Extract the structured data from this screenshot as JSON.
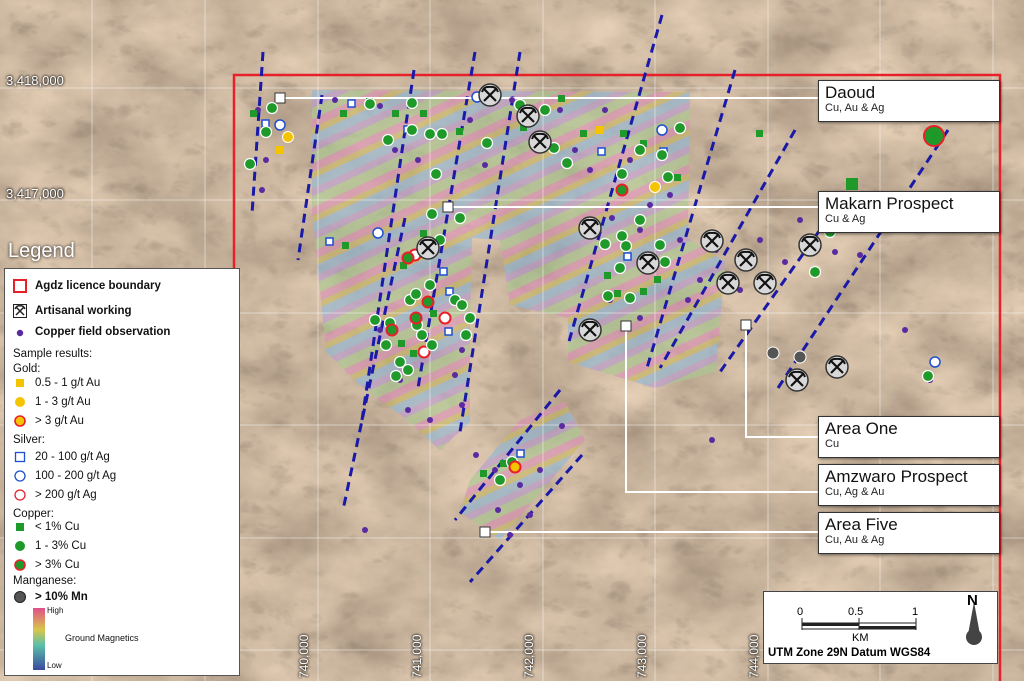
{
  "coordinates": {
    "northing": [
      "3,418,000",
      "3,417,000"
    ],
    "easting": [
      "740,000",
      "741,000",
      "742,000",
      "743,000",
      "744,000"
    ]
  },
  "callouts": [
    {
      "title": "Daoud",
      "sub": "Cu, Au & Ag"
    },
    {
      "title": "Makarn Prospect",
      "sub": "Cu & Ag"
    },
    {
      "title": "Area One",
      "sub": "Cu"
    },
    {
      "title": "Amzwaro Prospect",
      "sub": "Cu, Ag & Au"
    },
    {
      "title": "Area Five",
      "sub": "Cu, Au & Ag"
    }
  ],
  "legend": {
    "title": "Legend",
    "licence": "Agdz licence boundary",
    "artisanal": "Artisanal working",
    "copper_obs": "Copper field observation",
    "sample_results": "Sample results:",
    "gold_header": "Gold:",
    "gold": [
      "0.5 - 1 g/t Au",
      "1 - 3 g/t Au",
      "> 3 g/t Au"
    ],
    "silver_header": "Silver:",
    "silver": [
      "20 - 100 g/t Ag",
      "100 - 200 g/t Ag",
      "> 200 g/t Ag"
    ],
    "copper_header": "Copper:",
    "copper": [
      "< 1% Cu",
      "1 - 3% Cu",
      "> 3% Cu"
    ],
    "manganese_header": "Manganese:",
    "manganese": [
      "> 10% Mn"
    ],
    "mag_high": "High",
    "mag_low": "Low",
    "mag_label": "Ground Magnetics"
  },
  "scale": {
    "ticks": [
      "0",
      "0.5",
      "1"
    ],
    "unit": "KM",
    "north": "N",
    "datum": "UTM Zone 29N Datum WGS84"
  },
  "colors": {
    "licence_boundary": "#e8202a",
    "dykes": "#1a1aa8",
    "gold": "#f5c400",
    "copper": "#1f9a2a",
    "silver_low": "#1d4fd0",
    "silver_high": "#e8202a",
    "copper_obs": "#5a2aa0",
    "manganese": "#555555"
  }
}
